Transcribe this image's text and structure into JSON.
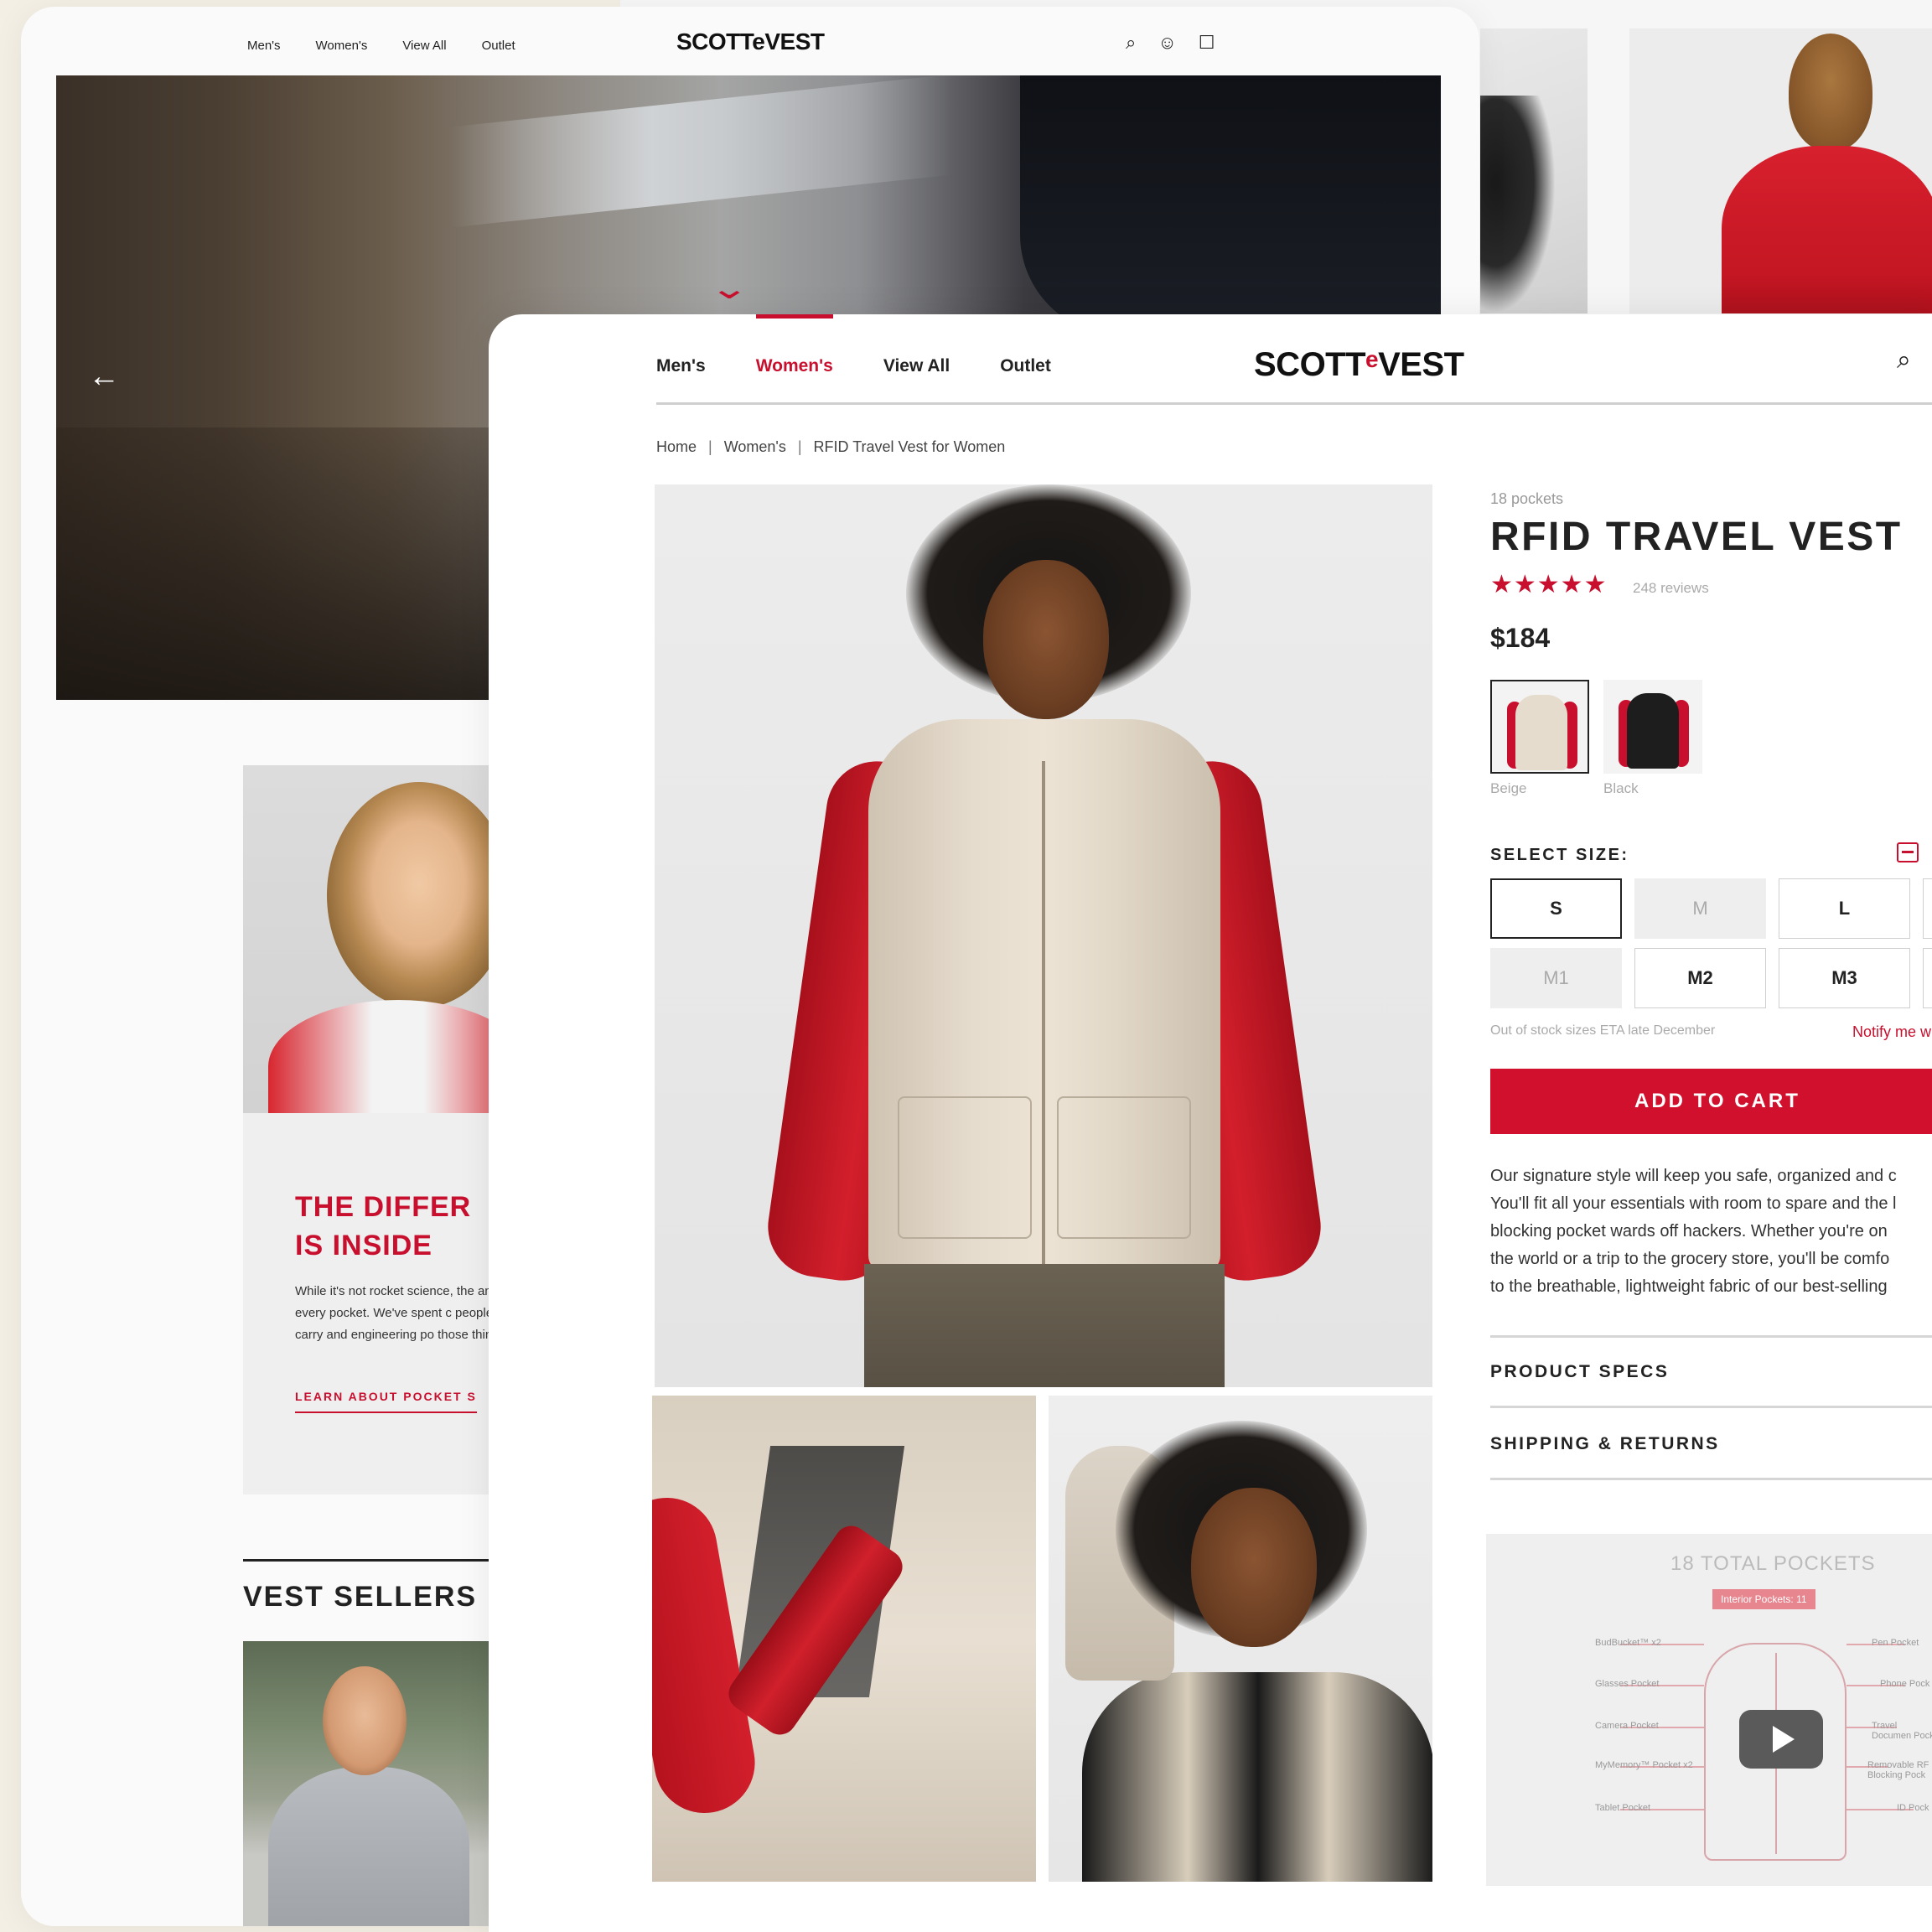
{
  "back_page": {
    "nav": {
      "links": [
        "Men's",
        "Women's",
        "View All",
        "Outlet"
      ],
      "logo": "SCOTTeVEST"
    },
    "feature": {
      "title": "THE DIFFER\nIS INSIDE",
      "text": "While it's not rocket science, the and every pocket. We've spent c people carry and engineering po those things.",
      "link": "LEARN ABOUT POCKET S"
    },
    "vest_sellers_title": "VEST SELLERS"
  },
  "front_page": {
    "nav": {
      "links": [
        "Men's",
        "Women's",
        "View All",
        "Outlet"
      ],
      "active": "Women's",
      "logo_left": "SCOTT",
      "logo_e": "e",
      "logo_right": "VEST"
    },
    "breadcrumb": [
      "Home",
      "Women's",
      "RFID Travel Vest for Women"
    ],
    "product": {
      "pockets_label": "18 pockets",
      "title": "RFID TRAVEL VEST",
      "stars": "★★★★★",
      "rating": 5,
      "reviews": "248 reviews",
      "price": "$184",
      "colors": [
        {
          "label": "Beige",
          "selected": true
        },
        {
          "label": "Black",
          "selected": false
        }
      ],
      "size_label": "SELECT SIZE:",
      "sizes": [
        {
          "label": "S",
          "state": "selected"
        },
        {
          "label": "M",
          "state": "out-of-stock"
        },
        {
          "label": "L",
          "state": "available"
        },
        {
          "label": "M1",
          "state": "out-of-stock"
        },
        {
          "label": "M2",
          "state": "available"
        },
        {
          "label": "M3",
          "state": "available"
        }
      ],
      "oos_note": "Out of stock sizes ETA late December",
      "notify": "Notify me w",
      "add_to_cart": "ADD TO CART",
      "description": [
        "Our signature style will keep you safe, organized and c",
        "You'll fit all your essentials with room to spare and the l",
        "blocking pocket wards off hackers. Whether you're on",
        "the world or a trip to the grocery store, you'll be comfo",
        "to the breathable, lightweight fabric of our best-selling"
      ],
      "accordions": [
        "PRODUCT SPECS",
        "SHIPPING & RETURNS"
      ]
    },
    "pocket_panel": {
      "title": "18 TOTAL POCKETS",
      "badge": "Interior Pockets: 11",
      "left_labels": [
        "BudBucket™ x2",
        "Glasses Pocket",
        "Camera Pocket",
        "MyMemory™ Pocket x2",
        "Tablet Pocket"
      ],
      "right_labels": [
        "Pen Pocket",
        "Phone Pock",
        "Travel Documen Pock",
        "Removable RF Blocking Pock",
        "ID Pock"
      ]
    }
  },
  "colors": {
    "accent": "#c8102e",
    "cart": "#d0102c",
    "text": "#222222",
    "muted": "#aaaaaa"
  }
}
